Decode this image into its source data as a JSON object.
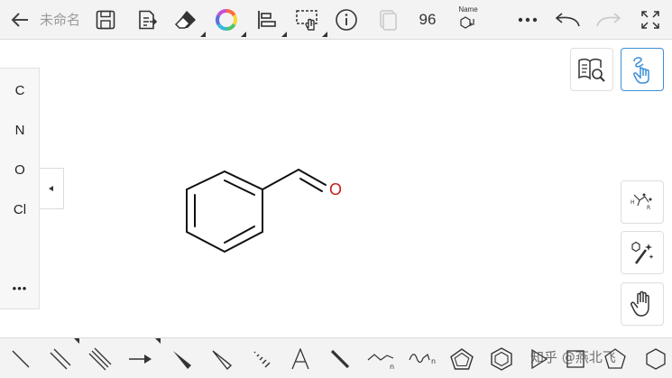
{
  "document": {
    "title": "未命名",
    "count": "96",
    "name_label": "Name"
  },
  "elements": [
    "C",
    "N",
    "O",
    "Cl"
  ],
  "more_label": "•••",
  "molecule": {
    "heteroatom": "O",
    "heteroatom_color": "#cc1a1a"
  },
  "watermark": "知乎 @燕北飞",
  "colors": {
    "toolbar_bg": "#f3f3f3",
    "accent": "#3b8fd8",
    "icon": "#333333"
  }
}
